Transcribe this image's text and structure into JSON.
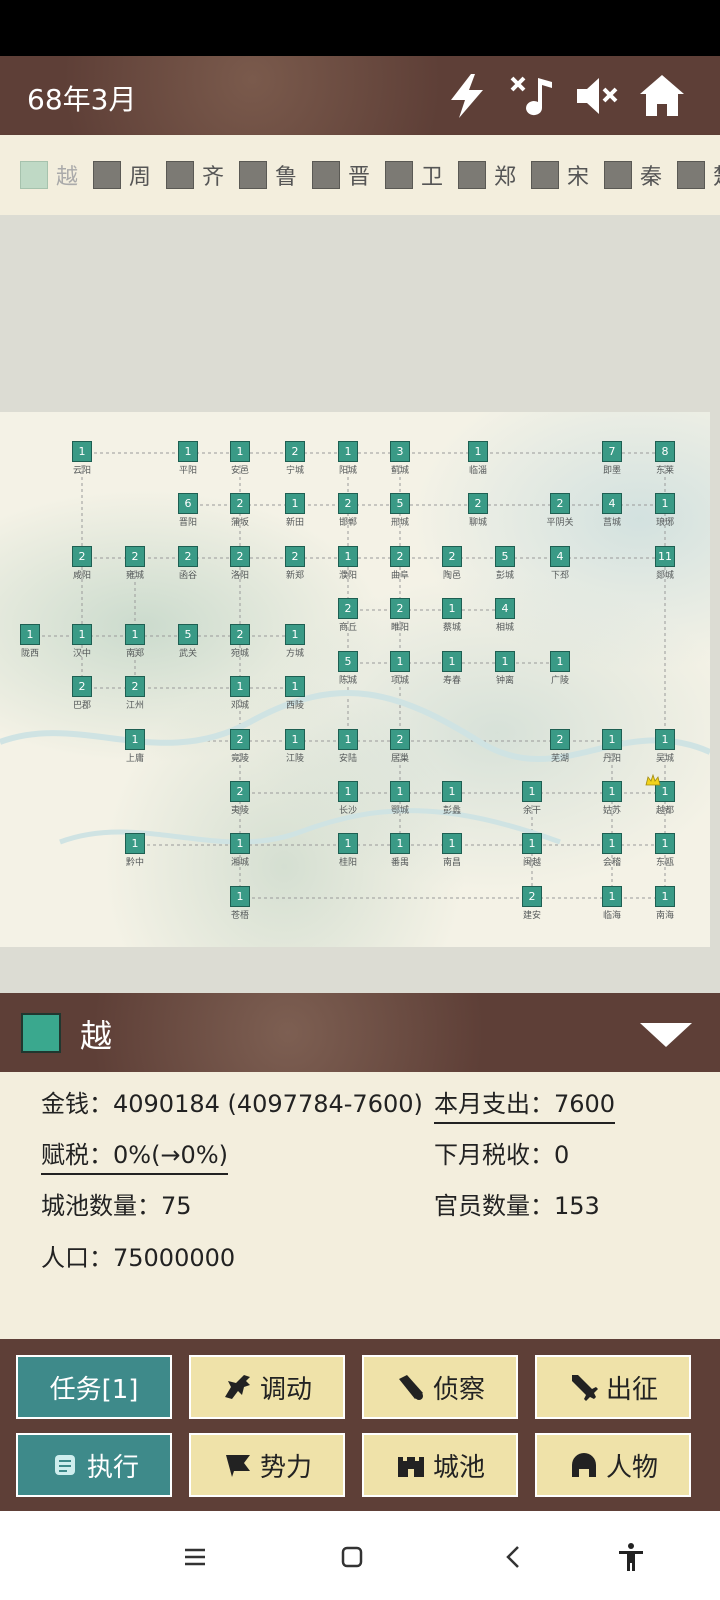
{
  "status_bar": {},
  "header": {
    "date": "68年3月",
    "icons": [
      "lightning-icon",
      "music-off-icon",
      "sound-mute-icon",
      "home-icon"
    ]
  },
  "factions": [
    {
      "name": "越",
      "selected": true
    },
    {
      "name": "周"
    },
    {
      "name": "齐"
    },
    {
      "name": "鲁"
    },
    {
      "name": "晋"
    },
    {
      "name": "卫"
    },
    {
      "name": "郑"
    },
    {
      "name": "宋"
    },
    {
      "name": "秦"
    },
    {
      "name": "楚"
    }
  ],
  "map": {
    "city_color": "#3a9a86",
    "cities": [
      {
        "n": "1",
        "name": "云阳"
      },
      {
        "n": "1",
        "name": "平阳"
      },
      {
        "n": "1",
        "name": "安邑"
      },
      {
        "n": "2",
        "name": "宁城"
      },
      {
        "n": "1",
        "name": "阳城"
      },
      {
        "n": "3",
        "name": "蓟城"
      },
      {
        "n": "1",
        "name": "临淄"
      },
      {
        "n": "7",
        "name": "即墨"
      },
      {
        "n": "8",
        "name": "东莱"
      },
      {
        "n": "6",
        "name": "晋阳"
      },
      {
        "n": "2",
        "name": "蒲坂"
      },
      {
        "n": "1",
        "name": "新田"
      },
      {
        "n": "2",
        "name": "邯郸"
      },
      {
        "n": "5",
        "name": "邢城"
      },
      {
        "n": "2",
        "name": "聊城"
      },
      {
        "n": "2",
        "name": "平阴关"
      },
      {
        "n": "4",
        "name": "莒城"
      },
      {
        "n": "1",
        "name": "琅琊"
      },
      {
        "n": "2",
        "name": "咸阳"
      },
      {
        "n": "2",
        "name": "雍城"
      },
      {
        "n": "2",
        "name": "函谷"
      },
      {
        "n": "2",
        "name": "洛阳"
      },
      {
        "n": "2",
        "name": "新郑"
      },
      {
        "n": "1",
        "name": "濮阳"
      },
      {
        "n": "2",
        "name": "曲阜"
      },
      {
        "n": "2",
        "name": "陶邑"
      },
      {
        "n": "5",
        "name": "彭城"
      },
      {
        "n": "4",
        "name": "下邳"
      },
      {
        "n": "11",
        "name": "郯城"
      },
      {
        "n": "2",
        "name": "商丘"
      },
      {
        "n": "2",
        "name": "睢阳"
      },
      {
        "n": "1",
        "name": "蔡城"
      },
      {
        "n": "4",
        "name": "相城"
      },
      {
        "n": "1",
        "name": "陇西"
      },
      {
        "n": "1",
        "name": "汉中"
      },
      {
        "n": "1",
        "name": "南郑"
      },
      {
        "n": "5",
        "name": "武关"
      },
      {
        "n": "2",
        "name": "宛城"
      },
      {
        "n": "1",
        "name": "方城"
      },
      {
        "n": "5",
        "name": "陈城"
      },
      {
        "n": "1",
        "name": "项城"
      },
      {
        "n": "1",
        "name": "寿春"
      },
      {
        "n": "1",
        "name": "钟离"
      },
      {
        "n": "1",
        "name": "广陵"
      },
      {
        "n": "2",
        "name": "巴郡"
      },
      {
        "n": "2",
        "name": "江州"
      },
      {
        "n": "1",
        "name": "邓城"
      },
      {
        "n": "1",
        "name": "西陵"
      },
      {
        "n": "1",
        "name": "上庸"
      },
      {
        "n": "2",
        "name": "竟陵"
      },
      {
        "n": "1",
        "name": "江陵"
      },
      {
        "n": "1",
        "name": "安陆"
      },
      {
        "n": "2",
        "name": "居巢"
      },
      {
        "n": "2",
        "name": "芜湖"
      },
      {
        "n": "1",
        "name": "丹阳"
      },
      {
        "n": "1",
        "name": "吴城"
      },
      {
        "n": "2",
        "name": "夷陵"
      },
      {
        "n": "1",
        "name": "长沙"
      },
      {
        "n": "1",
        "name": "鄂城"
      },
      {
        "n": "1",
        "name": "彭蠡"
      },
      {
        "n": "1",
        "name": "余干"
      },
      {
        "n": "1",
        "name": "姑苏"
      },
      {
        "n": "1",
        "name": "越都"
      },
      {
        "n": "1",
        "name": "黔中"
      },
      {
        "n": "1",
        "name": "湘城"
      },
      {
        "n": "1",
        "name": "桂阳"
      },
      {
        "n": "1",
        "name": "番禺"
      },
      {
        "n": "1",
        "name": "南昌"
      },
      {
        "n": "1",
        "name": "闽越"
      },
      {
        "n": "1",
        "name": "会稽"
      },
      {
        "n": "1",
        "name": "东瓯"
      },
      {
        "n": "1",
        "name": "苍梧"
      },
      {
        "n": "2",
        "name": "建安"
      },
      {
        "n": "1",
        "name": "临海"
      },
      {
        "n": "1",
        "name": "南海"
      }
    ]
  },
  "selected_faction": {
    "name": "越",
    "color": "#3aa88e"
  },
  "stats": {
    "money": "金钱：4090184 (4097784-7600)",
    "expense": "本月支出：7600",
    "tax": "赋税：0%(→0%)",
    "next_tax": "下月税收：0",
    "cities": "城池数量：75",
    "officials": "官员数量：153",
    "population": "人口：75000000"
  },
  "buttons": [
    {
      "label": "任务[1]",
      "icon": ""
    },
    {
      "label": "调动",
      "icon": "horse-icon"
    },
    {
      "label": "侦察",
      "icon": "telescope-icon"
    },
    {
      "label": "出征",
      "icon": "sword-icon"
    },
    {
      "label": "执行",
      "icon": "scroll-icon"
    },
    {
      "label": "势力",
      "icon": "flag-icon"
    },
    {
      "label": "城池",
      "icon": "castle-icon"
    },
    {
      "label": "人物",
      "icon": "helmet-icon"
    }
  ],
  "nav": [
    "menu-icon",
    "home-square-icon",
    "back-icon",
    "accessibility-icon"
  ]
}
